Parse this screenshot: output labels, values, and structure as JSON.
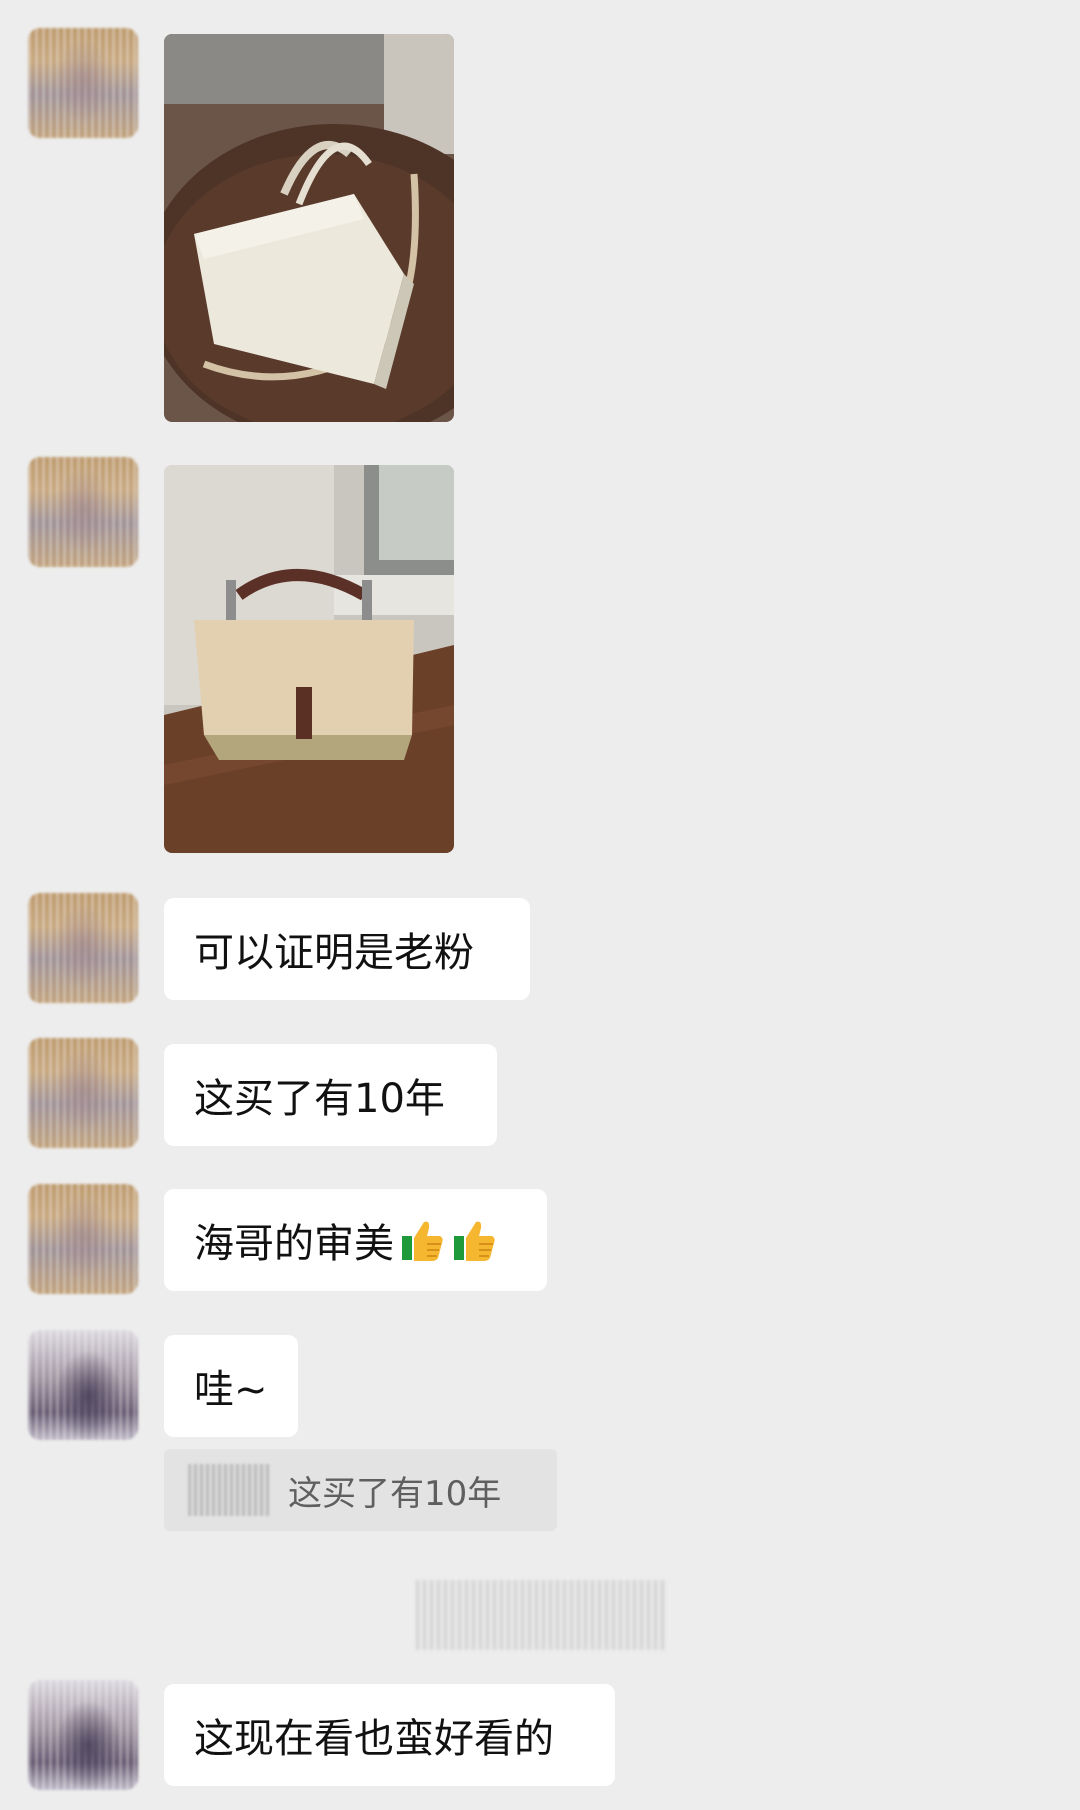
{
  "messages": {
    "m3": "可以证明是老粉",
    "m4": "这买了有10年",
    "m5": "海哥的审美",
    "m6": "哇~",
    "m6_quote": "这买了有10年",
    "m7": "这现在看也蛮好看的"
  },
  "icons": {
    "thumbs_up": "thumbs-up-emoji"
  }
}
